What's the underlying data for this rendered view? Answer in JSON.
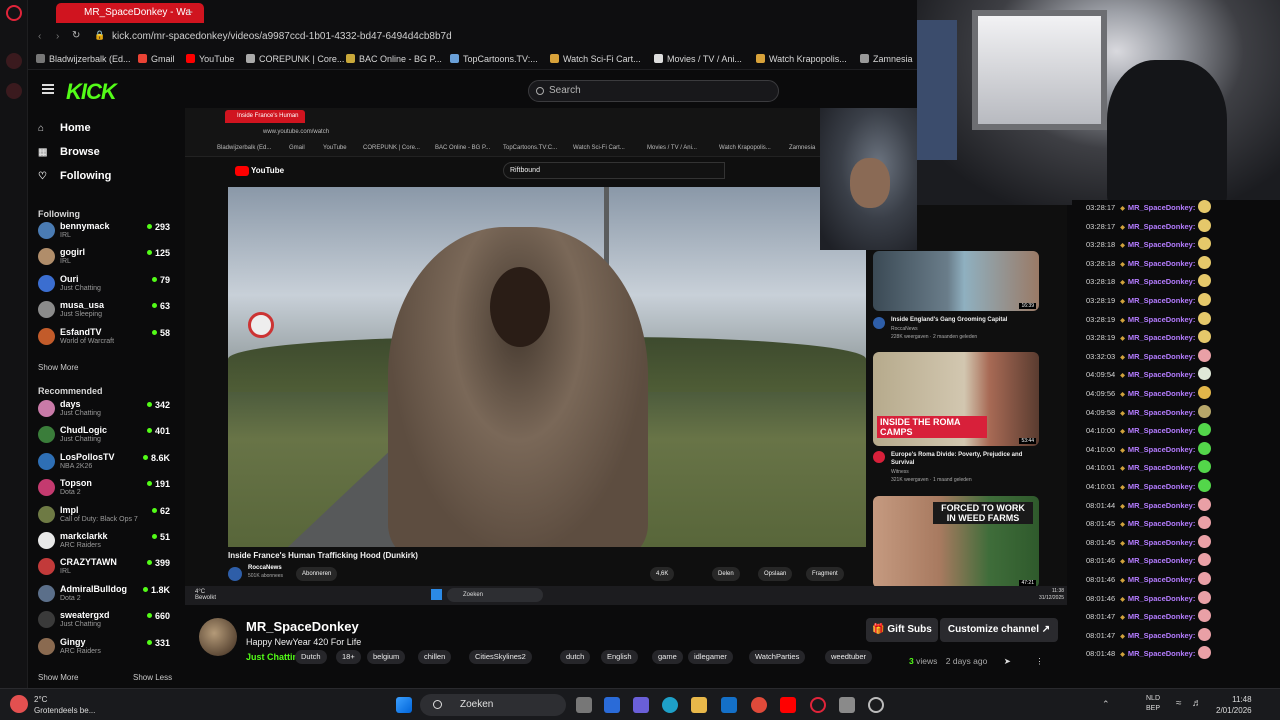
{
  "outer_browser": {
    "active_tab_title": "MR_SpaceDonkey - Wa",
    "url": "kick.com/mr-spacedonkey/videos/a9987ccd-1b01-4332-bd47-6494d4cb8b7d",
    "bookmarks": [
      "Bladwijzerbalk (Ed...",
      "Gmail",
      "YouTube",
      "COREPUNK | Core...",
      "BAC Online - BG P...",
      "TopCartoons.TV:...",
      "Watch Sci-Fi Cart...",
      "Movies / TV / Ani...",
      "Watch Krapopolis...",
      "Zamnesia"
    ]
  },
  "kick": {
    "logo": "KICK",
    "search_placeholder": "Search",
    "nav": [
      {
        "label": "Home",
        "icon": "home-icon"
      },
      {
        "label": "Browse",
        "icon": "browse-icon"
      },
      {
        "label": "Following",
        "icon": "heart-icon"
      }
    ],
    "following_heading": "Following",
    "following": [
      {
        "name": "bennymack",
        "category": "IRL",
        "viewers": "293",
        "color": "#4a7bb3"
      },
      {
        "name": "gogirl",
        "category": "IRL",
        "viewers": "125",
        "color": "#b08d6a"
      },
      {
        "name": "Ouri",
        "category": "Just Chatting",
        "viewers": "79",
        "color": "#3b6ed0"
      },
      {
        "name": "musa_usa",
        "category": "Just Sleeping",
        "viewers": "63",
        "color": "#8b8b8b"
      },
      {
        "name": "EsfandTV",
        "category": "World of Warcraft",
        "viewers": "58",
        "color": "#c25b2a"
      }
    ],
    "show_more": "Show More",
    "recommended_heading": "Recommended",
    "recommended": [
      {
        "name": "days",
        "category": "Just Chatting",
        "viewers": "342",
        "color": "#c97aa8"
      },
      {
        "name": "ChudLogic",
        "category": "Just Chatting",
        "viewers": "401",
        "color": "#3a7d3a"
      },
      {
        "name": "LosPollosTV",
        "category": "NBA 2K26",
        "viewers": "8.6K",
        "color": "#2e6fb5"
      },
      {
        "name": "Topson",
        "category": "Dota 2",
        "viewers": "191",
        "color": "#c43a6f"
      },
      {
        "name": "lmpl",
        "category": "Call of Duty: Black Ops 7",
        "viewers": "62",
        "color": "#6e7a44"
      },
      {
        "name": "markclarkk",
        "category": "ARC Raiders",
        "viewers": "51",
        "color": "#e8e8e8"
      },
      {
        "name": "CRAZYTAWN",
        "category": "IRL",
        "viewers": "399",
        "color": "#c23a3a"
      },
      {
        "name": "AdmiralBulldog",
        "category": "Dota 2",
        "viewers": "1.8K",
        "color": "#5b6f8a"
      },
      {
        "name": "sweatergxd",
        "category": "Just Chatting",
        "viewers": "660",
        "color": "#3a3a3a"
      },
      {
        "name": "Gingy",
        "category": "ARC Raiders",
        "viewers": "331",
        "color": "#8a6a50"
      }
    ],
    "show_less": "Show Less"
  },
  "stream_capture": {
    "inner_tab_title": "Inside France's Human",
    "inner_url": "www.youtube.com/watch",
    "inner_bookmarks": [
      "Bladwijzerbalk (Ed...",
      "Gmail",
      "YouTube",
      "COREPUNK | Core...",
      "BAC Online - BG P...",
      "TopCartoons.TV:C...",
      "Watch Sci-Fi Cart...",
      "Movies / TV / Ani...",
      "Watch Krapopolis...",
      "Zamnesia"
    ],
    "youtube_search": "Riftbound",
    "youtube_logo": "YouTube",
    "video_title": "Inside France's Human Trafficking Hood (Dunkirk)",
    "channel": "RoccaNews",
    "subscribers": "501K abonnees",
    "subscribe": "Abonneren",
    "likes": "4,6K",
    "share": "Delen",
    "save": "Opslaan",
    "clip": "Fragment",
    "suggestions": [
      {
        "title": "Inside England's Gang Grooming Capital",
        "channel": "RoccaNews",
        "meta": "228K weergaven · 2 maanden geleden",
        "duration": "16:39",
        "thumb_text": ""
      },
      {
        "title": "Europe's Roma Divide: Poverty, Prejudice and Survival",
        "channel": "Witness",
        "meta": "321K weergaven · 1 maand geleden",
        "duration": "53:44",
        "thumb_text": "INSIDE THE ROMA CAMPS"
      },
      {
        "title": "",
        "channel": "",
        "meta": "",
        "duration": "47:21",
        "thumb_text": "FORCED TO WORK IN WEED FARMS"
      }
    ],
    "taskbar_search": "Zoeken",
    "weather": "4°C",
    "weather_desc": "Bewolkt",
    "time": "11:38",
    "date": "31/12/2025"
  },
  "chat": [
    {
      "time": "03:28:17",
      "user": "MR_SpaceDonkey:",
      "emote": "#e5c86a"
    },
    {
      "time": "03:28:17",
      "user": "MR_SpaceDonkey:",
      "emote": "#e5c86a"
    },
    {
      "time": "03:28:18",
      "user": "MR_SpaceDonkey:",
      "emote": "#e5c86a"
    },
    {
      "time": "03:28:18",
      "user": "MR_SpaceDonkey:",
      "emote": "#e5c86a"
    },
    {
      "time": "03:28:18",
      "user": "MR_SpaceDonkey:",
      "emote": "#e5c86a"
    },
    {
      "time": "03:28:19",
      "user": "MR_SpaceDonkey:",
      "emote": "#e5c86a"
    },
    {
      "time": "03:28:19",
      "user": "MR_SpaceDonkey:",
      "emote": "#e5c86a"
    },
    {
      "time": "03:28:19",
      "user": "MR_SpaceDonkey:",
      "emote": "#e5c86a"
    },
    {
      "time": "03:32:03",
      "user": "MR_SpaceDonkey:",
      "emote": "#e9a0a6"
    },
    {
      "time": "04:09:54",
      "user": "MR_SpaceDonkey:",
      "emote": "#dfe8d8"
    },
    {
      "time": "04:09:56",
      "user": "MR_SpaceDonkey:",
      "emote": "#e2b64a"
    },
    {
      "time": "04:09:58",
      "user": "MR_SpaceDonkey:",
      "emote": "#b8a76a"
    },
    {
      "time": "04:10:00",
      "user": "MR_SpaceDonkey:",
      "emote": "#53d64a"
    },
    {
      "time": "04:10:00",
      "user": "MR_SpaceDonkey:",
      "emote": "#53d64a"
    },
    {
      "time": "04:10:01",
      "user": "MR_SpaceDonkey:",
      "emote": "#53d64a"
    },
    {
      "time": "04:10:01",
      "user": "MR_SpaceDonkey:",
      "emote": "#53d64a"
    },
    {
      "time": "08:01:44",
      "user": "MR_SpaceDonkey:",
      "emote": "#e9a0a6"
    },
    {
      "time": "08:01:45",
      "user": "MR_SpaceDonkey:",
      "emote": "#e9a0a6"
    },
    {
      "time": "08:01:45",
      "user": "MR_SpaceDonkey:",
      "emote": "#e9a0a6"
    },
    {
      "time": "08:01:46",
      "user": "MR_SpaceDonkey:",
      "emote": "#e9a0a6"
    },
    {
      "time": "08:01:46",
      "user": "MR_SpaceDonkey:",
      "emote": "#e9a0a6"
    },
    {
      "time": "08:01:46",
      "user": "MR_SpaceDonkey:",
      "emote": "#e9a0a6"
    },
    {
      "time": "08:01:47",
      "user": "MR_SpaceDonkey:",
      "emote": "#e9a0a6"
    },
    {
      "time": "08:01:47",
      "user": "MR_SpaceDonkey:",
      "emote": "#e9a0a6"
    },
    {
      "time": "08:01:48",
      "user": "MR_SpaceDonkey:",
      "emote": "#e9a0a6"
    }
  ],
  "stream_info": {
    "streamer": "MR_SpaceDonkey",
    "title": "Happy NewYear 420 For Life",
    "category": "Just Chatting",
    "tags": [
      "Dutch",
      "18+",
      "belgium",
      "chillen",
      "CitiesSkylines2",
      "dutch",
      "English",
      "game",
      "idlegamer",
      "WatchParties",
      "weedtuber"
    ],
    "gift_subs": "Gift Subs",
    "customize": "Customize channel",
    "views_count": "3",
    "views_label": "views",
    "age": "2 days ago"
  },
  "taskbar": {
    "temp": "2°C",
    "weather": "Grotendeels be...",
    "search": "Zoeken",
    "lang1": "NLD",
    "lang2": "BEP",
    "time": "11:48",
    "date": "2/01/2026"
  },
  "colors": {
    "accent": "#53fc18",
    "chat_user": "#b47cff",
    "youtube_red": "#ff0000"
  }
}
